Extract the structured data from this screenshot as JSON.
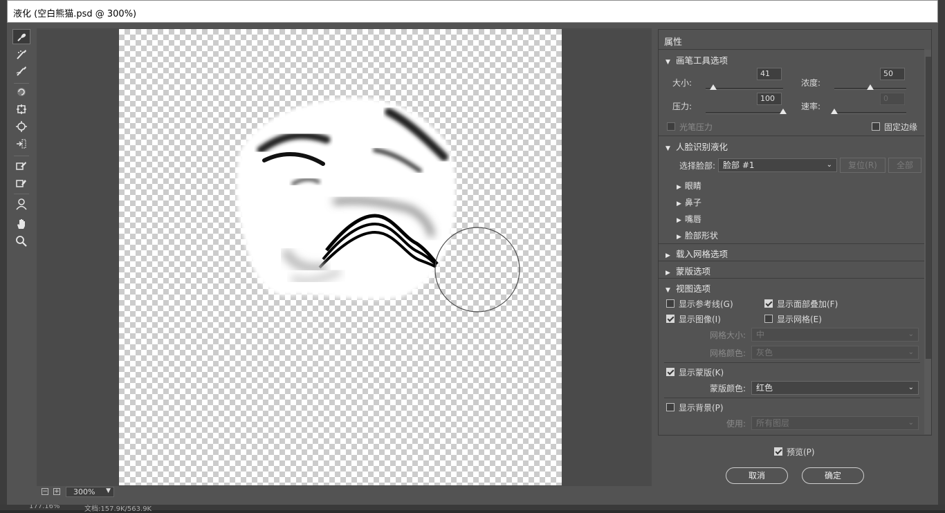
{
  "window": {
    "title": "液化 (空白熊猫.psd @ 300%)"
  },
  "tools": [
    {
      "name": "forward-warp-tool-icon",
      "active": true
    },
    {
      "name": "reconstruct-tool-icon"
    },
    {
      "name": "smooth-tool-icon"
    },
    {
      "name": "twirl-clockwise-tool-icon"
    },
    {
      "name": "pucker-tool-icon"
    },
    {
      "name": "bloat-tool-icon"
    },
    {
      "name": "push-left-tool-icon"
    },
    {
      "name": "freeze-mask-tool-icon"
    },
    {
      "name": "thaw-mask-tool-icon"
    },
    {
      "name": "face-tool-icon"
    },
    {
      "name": "hand-tool-icon"
    },
    {
      "name": "zoom-tool-icon"
    }
  ],
  "zoom": {
    "minus": "−",
    "plus": "+",
    "value": "300%"
  },
  "properties": {
    "title": "属性",
    "brush": {
      "header": "画笔工具选项",
      "size_label": "大小:",
      "size": "41",
      "size_fraction": 0.1,
      "density_label": "浓度:",
      "density": "50",
      "density_fraction": 0.5,
      "pressure_label": "压力:",
      "pressure": "100",
      "pressure_fraction": 1.0,
      "rate_label": "速率:",
      "rate": "0",
      "rate_fraction": 0.0,
      "stylus_label": "光笔压力",
      "pin_edges_label": "固定边缘"
    },
    "face": {
      "header": "人脸识别液化",
      "select_label": "选择脸部:",
      "select_value": "脸部 #1",
      "reset_label": "复位(R)",
      "all_label": "全部",
      "items": [
        "眼睛",
        "鼻子",
        "嘴唇",
        "脸部形状"
      ]
    },
    "load_mesh": "载入网格选项",
    "mask": "蒙版选项",
    "view": {
      "header": "视图选项",
      "guides_label": "显示参考线(G)",
      "face_overlay_label": "显示面部叠加(F)",
      "image_label": "显示图像(I)",
      "mesh_label": "显示网格(E)",
      "mesh_size_label": "网格大小:",
      "mesh_size_value": "中",
      "mesh_color_label": "网格颜色:",
      "mesh_color_value": "灰色",
      "show_mask_label": "显示蒙版(K)",
      "mask_color_label": "蒙版颜色:",
      "mask_color_value": "红色",
      "show_backdrop_label": "显示背景(P)",
      "use_label": "使用:",
      "use_value": "所有图层"
    }
  },
  "footer": {
    "preview_label": "预览(P)",
    "cancel_label": "取消",
    "ok_label": "确定"
  },
  "status": {
    "zoom": "177.16%",
    "doc": "文档:157.9K/563.9K"
  }
}
